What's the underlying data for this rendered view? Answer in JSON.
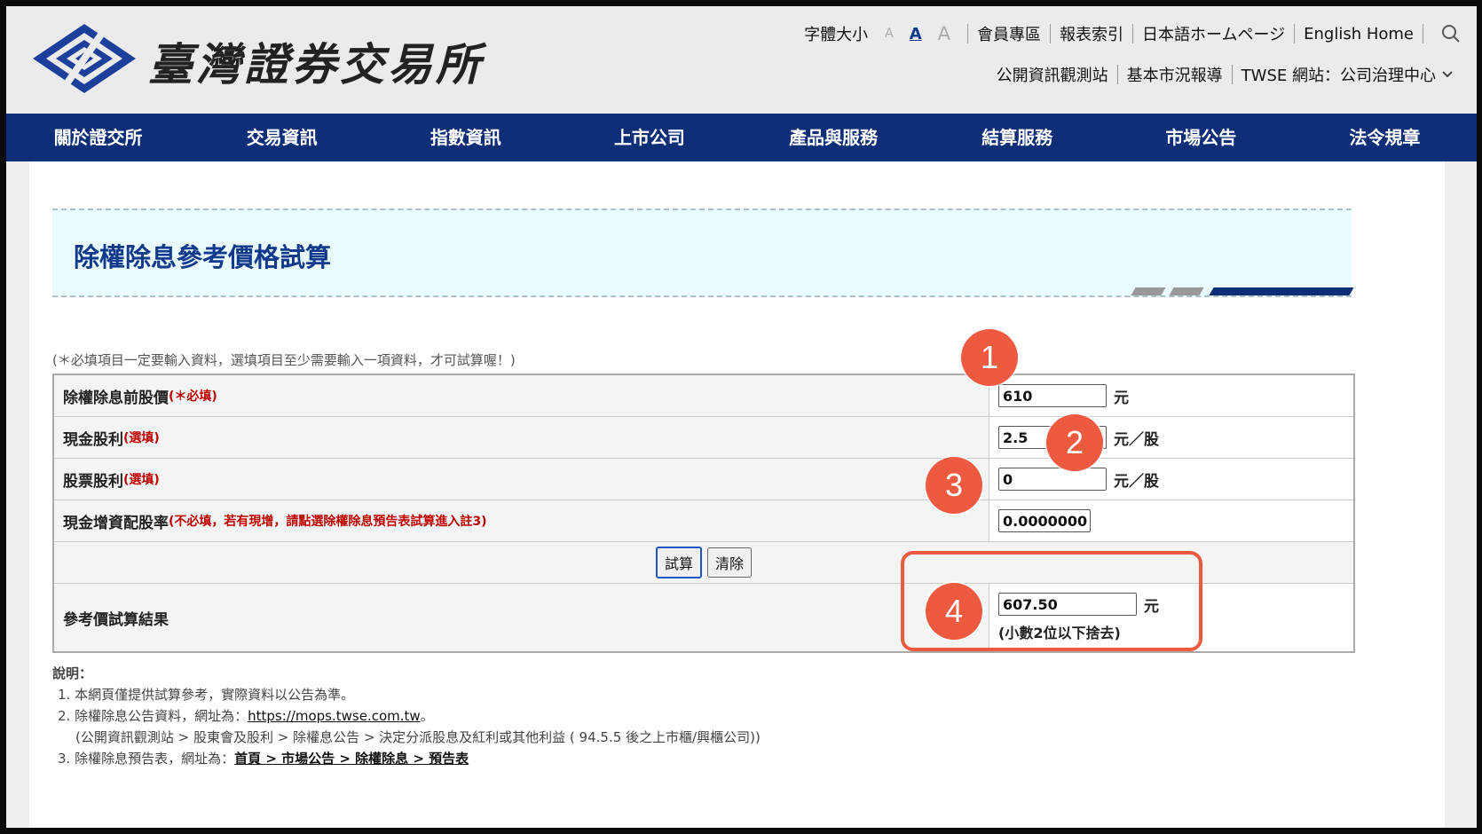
{
  "header": {
    "site_title": "臺灣證券交易所",
    "font_size_label": "字體大小",
    "font_size_options": [
      "A",
      "A",
      "A"
    ],
    "top_links": [
      "會員專區",
      "報表索引",
      "日本語ホームページ",
      "English Home"
    ],
    "sub_links": [
      "公開資訊觀測站",
      "基本市況報導",
      "TWSE 網站：公司治理中心"
    ]
  },
  "nav": {
    "items": [
      "關於證交所",
      "交易資訊",
      "指數資訊",
      "上市公司",
      "產品與服務",
      "結算服務",
      "市場公告",
      "法令規章"
    ]
  },
  "page": {
    "title": "除權除息參考價格試算",
    "note": "(＊必填項目一定要輸入資料，選填項目至少需要輸入一項資料，才可試算喔！)"
  },
  "form": {
    "rows": [
      {
        "label": "除權除息前股價",
        "tag": "(＊必填)",
        "value": "610",
        "unit": "元"
      },
      {
        "label": "現金股利",
        "tag": "(選填)",
        "value": "2.5",
        "unit": "元／股"
      },
      {
        "label": "股票股利",
        "tag": "(選填)",
        "value": "0",
        "unit": "元／股"
      },
      {
        "label": "現金增資配股率",
        "tag": "(不必填，若有現增，請點選除權除息預告表試算進入註3)",
        "value": "0.0000000",
        "unit": ""
      }
    ],
    "calc_button": "試算",
    "clear_button": "清除",
    "result_label": "參考價試算結果",
    "result_value": "607.50",
    "result_unit": "元",
    "result_note": "(小數2位以下捨去)"
  },
  "notes": {
    "heading": "說明：",
    "line1": "1. 本網頁僅提供試算參考，實際資料以公告為準。",
    "line2_prefix": "2. 除權除息公告資料，網址為：",
    "line2_link": "https://mops.twse.com.tw",
    "line2_suffix": "。",
    "line2_sub": "(公開資訊觀測站 > 股東會及股利 > 除權息公告 > 決定分派股息及紅利或其他利益 ( 94.5.5 後之上市櫃/興櫃公司))",
    "line3_prefix": "3. 除權除息預告表，網址為：",
    "line3_link": "首頁 > 市場公告 > 除權除息 > 預告表"
  },
  "annotations": [
    "1",
    "2",
    "3",
    "4"
  ],
  "colors": {
    "nav_bg": "#0e2e78",
    "title_text": "#123a8c",
    "badge": "#ee5a40",
    "required": "#c00000"
  }
}
